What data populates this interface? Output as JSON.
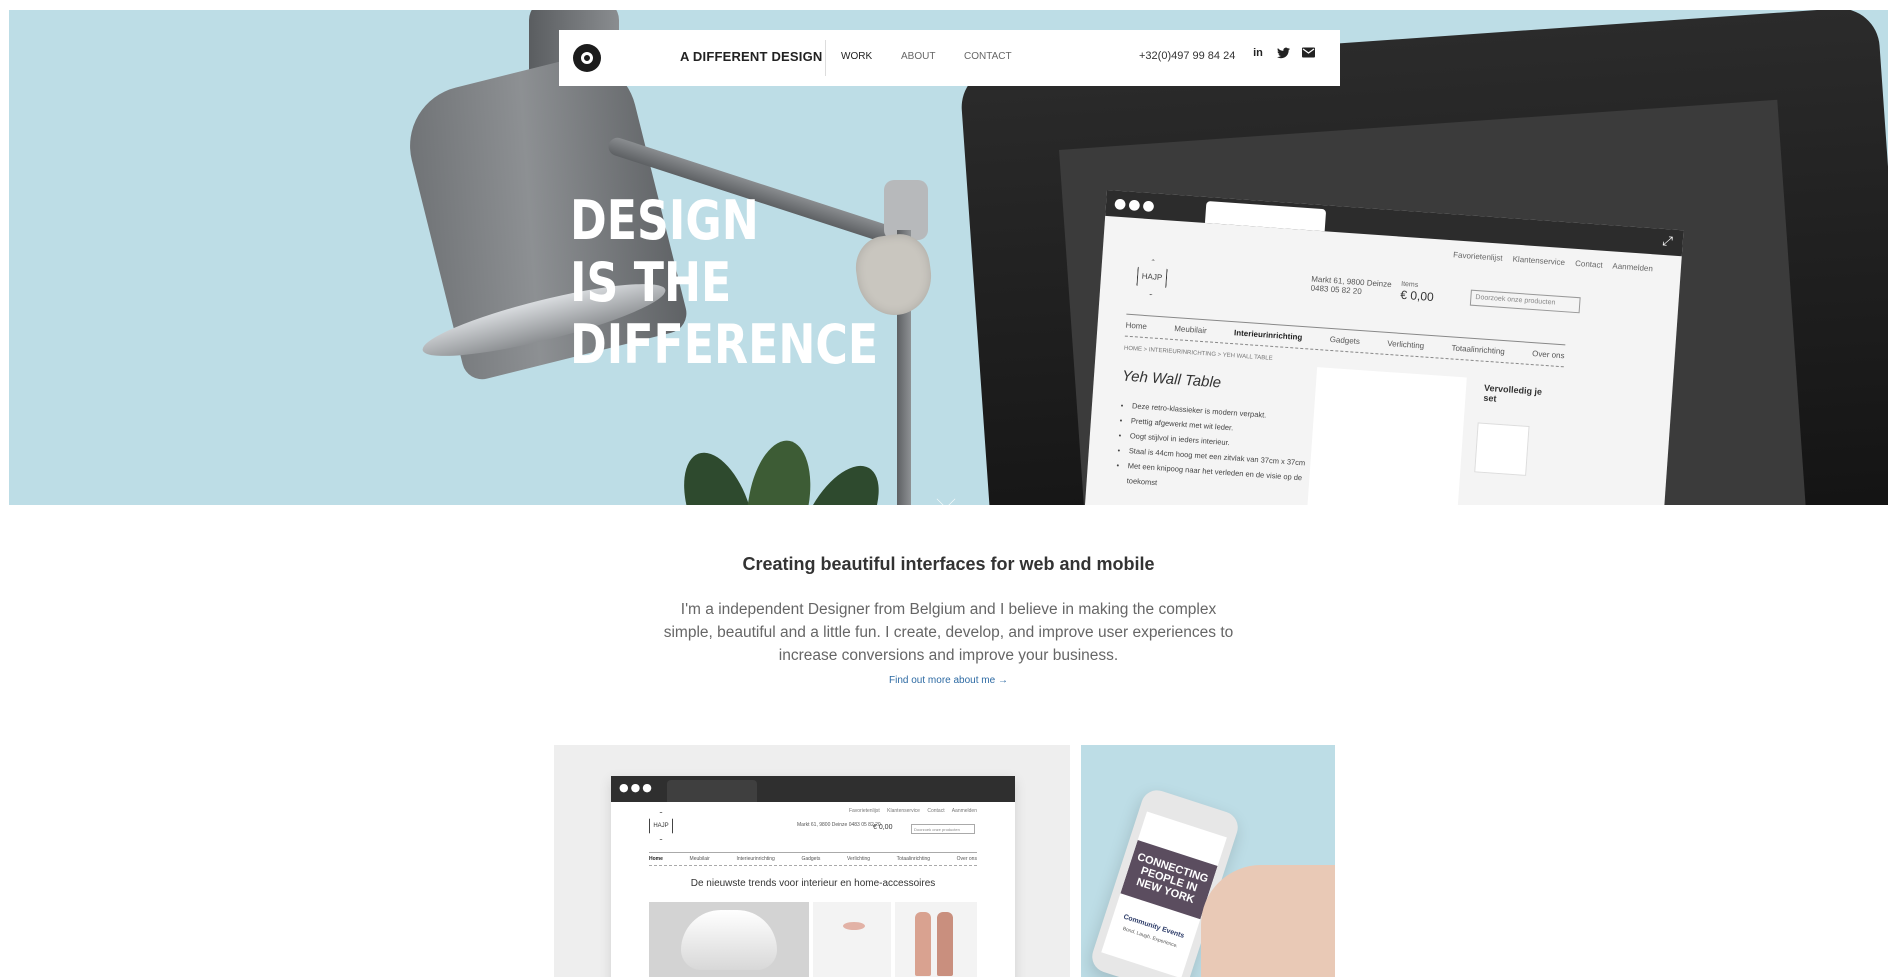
{
  "header": {
    "brand": "A DIFFERENT DESIGN",
    "nav": [
      "WORK",
      "ABOUT",
      "CONTACT"
    ],
    "active_nav": "WORK",
    "phone": "+32(0)497 99 84 24",
    "social_icons": [
      "linkedin-icon",
      "twitter-icon",
      "mail-icon"
    ]
  },
  "hero": {
    "lines": [
      "DESIGN",
      "IS THE",
      "DIFFERENCE"
    ],
    "background": "#bddde6",
    "mockup": {
      "top_links": "Favorietenlijst Klantenservice Contact Aanmelden",
      "logo": "HAJP",
      "address": "Markt 61, 9800 Deinze",
      "phone": "0483 05 82 20",
      "items_label": "Items",
      "total": "€ 0,00",
      "search_placeholder": "Doorzoek onze producten",
      "nav": [
        "Home",
        "Meubilair",
        "Interieurinrichting",
        "Gadgets",
        "Verlichting",
        "Totaalinrichting",
        "Over ons"
      ],
      "breadcrumb": "HOME > INTERIEURINRICHTING > YEH WALL TABLE",
      "product_title": "Yeh Wall Table",
      "bullets": [
        "Deze retro-klassieker is modern verpakt.",
        "Prettig afgewerkt met wit leder.",
        "Oogt stijlvol in ieders interieur.",
        "Staal is 44cm hoog met een zitvlak van 37cm x 37cm",
        "Met een knipoog naar het verleden en de visie op de toekomst"
      ],
      "side_title": "Vervolledig je set"
    }
  },
  "intro": {
    "title": "Creating beautiful interfaces for web and mobile",
    "body": "I'm a independent Designer from Belgium and I believe in making the complex simple, beautiful and a little fun. I create, develop, and improve user experiences to increase conversions and improve your business.",
    "link": "Find out more about me →"
  },
  "portfolio": {
    "card1": {
      "top_links": "Favorietenlijst Klantenservice Contact Aanmelden",
      "logo": "HAJP",
      "address": "Markt 61, 9800 Deinze 0483 05 82 20",
      "total": "€ 0,00",
      "search_placeholder": "Doorzoek onze producten",
      "nav": [
        "Home",
        "Meubilair",
        "Interieurinrichting",
        "Gadgets",
        "Verlichting",
        "Totaalinrichting",
        "Over ons"
      ],
      "heading": "De nieuwste trends voor interieur en home-accessoires"
    },
    "card2": {
      "headline": "CONNECTING PEOPLE IN NEW YORK",
      "event_title": "Community Events",
      "event_sub": "Bond. Laugh. Experience."
    }
  }
}
